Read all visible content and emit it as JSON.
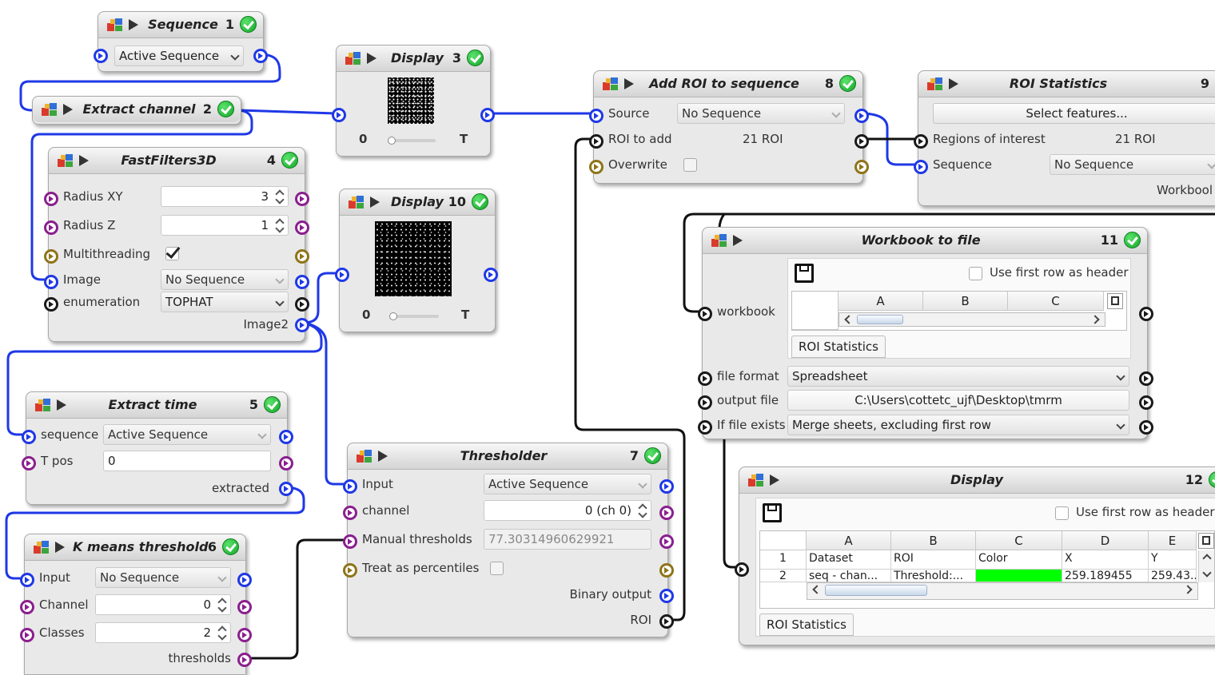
{
  "colors": {
    "wire_blue": "#1f38e6",
    "wire_black": "#111111",
    "port_purple": "#8a1f8e",
    "port_olive": "#8e7418",
    "ok_green": "#14a52a",
    "color_cell_green": "#00ff00"
  },
  "icons": {
    "block_logo": "colored-blocks-logo-icon",
    "run": "play-icon",
    "status": "green-check-icon",
    "save": "floppy-disk-save-icon"
  },
  "blocks": {
    "b1": {
      "title": "Sequence",
      "num": "1",
      "combo": "Active Sequence"
    },
    "b2": {
      "title": "Extract channel",
      "num": "2"
    },
    "b3": {
      "title": "Display",
      "num": "3",
      "slider_min": "0",
      "slider_max": "T"
    },
    "b4": {
      "title": "FastFilters3D",
      "num": "4",
      "radius_xy_label": "Radius XY",
      "radius_xy": "3",
      "radius_z_label": "Radius Z",
      "radius_z": "1",
      "multithreading_label": "Multithreading",
      "image_label": "Image",
      "image": "No Sequence",
      "enum_label": "enumeration",
      "enum": "TOPHAT",
      "output_label": "Image2"
    },
    "b10": {
      "title": "Display",
      "num": "10",
      "slider_min": "0",
      "slider_max": "T"
    },
    "b5": {
      "title": "Extract time",
      "num": "5",
      "seq_label": "sequence",
      "seq": "Active Sequence",
      "tpos_label": "T pos",
      "tpos": "0",
      "output_label": "extracted"
    },
    "b6": {
      "title": "K means threshold",
      "num": "6",
      "input_label": "Input",
      "input": "No Sequence",
      "channel_label": "Channel",
      "channel": "0",
      "classes_label": "Classes",
      "classes": "2",
      "output_label": "thresholds"
    },
    "b7": {
      "title": "Thresholder",
      "num": "7",
      "input_label": "Input",
      "input": "Active Sequence",
      "channel_label": "channel",
      "channel": "0 (ch 0)",
      "manual_label": "Manual thresholds",
      "manual": "77.30314960629921",
      "pct_label": "Treat as percentiles",
      "out1_label": "Binary output",
      "out2_label": "ROI"
    },
    "b8": {
      "title": "Add ROI to sequence",
      "num": "8",
      "source_label": "Source",
      "source": "No Sequence",
      "roi_label": "ROI to add",
      "roi": "21 ROI",
      "overwrite_label": "Overwrite"
    },
    "b9": {
      "title": "ROI Statistics",
      "num": "9",
      "select_btn": "Select features...",
      "roi_label": "Regions of interest",
      "roi": "21 ROI",
      "seq_label": "Sequence",
      "seq": "No Sequence",
      "output_label": "Workbool"
    },
    "b11": {
      "title": "Workbook to file",
      "num": "11",
      "workbook_label": "workbook",
      "header_label": "Use first row as header",
      "cols": [
        "A",
        "B",
        "C"
      ],
      "sheet_tab": "ROI Statistics",
      "format_label": "file format",
      "format": "Spreadsheet",
      "file_label": "output file",
      "file": "C:\\Users\\cottetc_ujf\\Desktop\\tmrm",
      "exists_label": "If file exists",
      "exists": "Merge sheets, excluding first row"
    },
    "b12": {
      "title": "Display",
      "num": "12",
      "header_label": "Use first row as header",
      "cols": [
        "A",
        "B",
        "C",
        "D",
        "E"
      ],
      "rows": [
        {
          "n": "1",
          "cells": [
            "Dataset",
            "ROI",
            "Color",
            "X",
            "Y"
          ]
        },
        {
          "n": "2",
          "cells": [
            "seq - chan...",
            "Threshold:...",
            "",
            "259.189455",
            "259.43..."
          ]
        }
      ],
      "sheet_tab": "ROI Statistics"
    }
  }
}
